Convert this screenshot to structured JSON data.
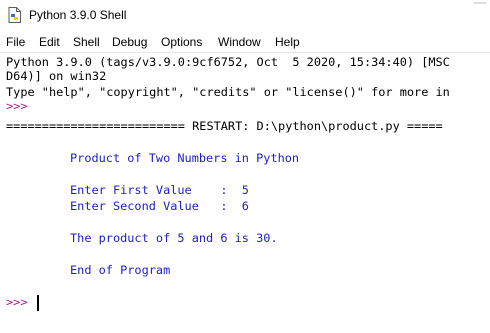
{
  "window": {
    "title": "Python 3.9.0 Shell"
  },
  "menu": {
    "items": [
      {
        "label": "File"
      },
      {
        "label": "Edit"
      },
      {
        "label": "Shell"
      },
      {
        "label": "Debug"
      },
      {
        "label": "Options"
      },
      {
        "label": "Window"
      },
      {
        "label": "Help"
      }
    ]
  },
  "shell": {
    "banner_line1": "Python 3.9.0 (tags/v3.9.0:9cf6752, Oct  5 2020, 15:34:40) [MSC",
    "banner_line2": "D64)] on win32",
    "banner_line3": "Type \"help\", \"copyright\", \"credits\" or \"license()\" for more in",
    "prompt": ">>>",
    "restart_line": "========================= RESTART: D:\\python\\product.py =====",
    "output": {
      "heading": "Product of Two Numbers in Python",
      "first_value": "Enter First Value    :  5",
      "second_value": "Enter Second Value   :  6",
      "result": "The product of 5 and 6 is 30.",
      "end": "End of Program"
    }
  },
  "colors": {
    "prompt": "#b5178a",
    "output": "#2020c8",
    "text": "#000000",
    "background": "#ffffff"
  },
  "icons": {
    "title": "idle-python-icon"
  }
}
